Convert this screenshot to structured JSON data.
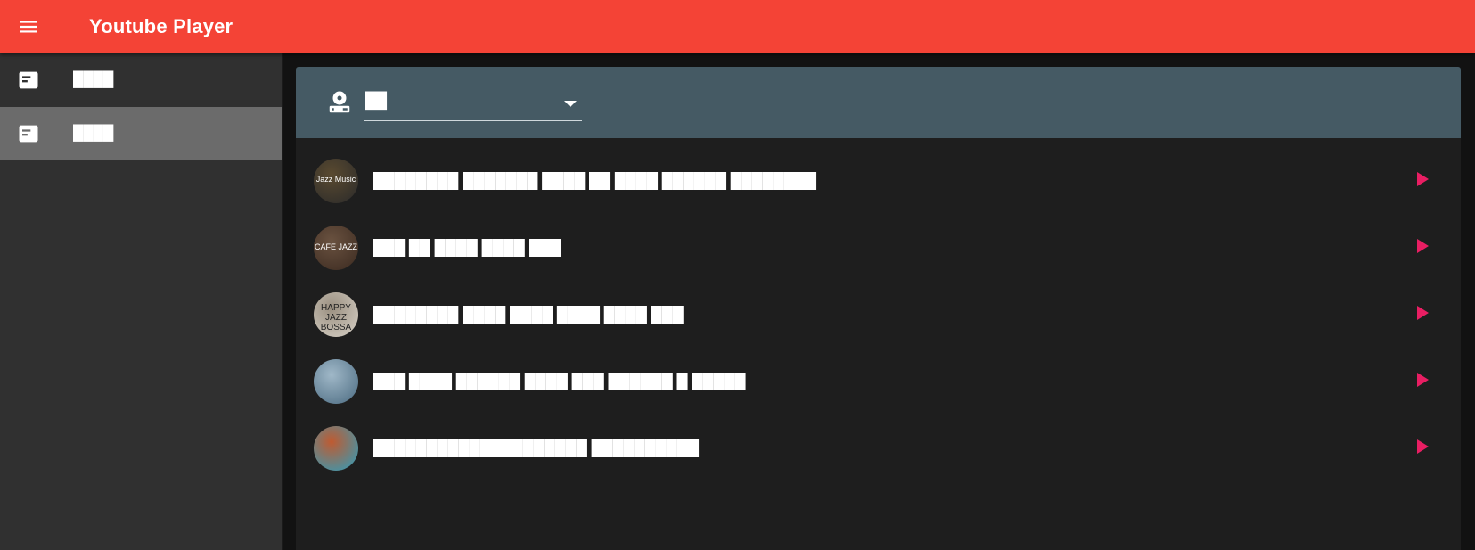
{
  "app": {
    "title": "Youtube Player"
  },
  "sidebar": {
    "items": [
      {
        "label": "████",
        "icon": "list-alt-icon",
        "active": false
      },
      {
        "label": "████",
        "icon": "list-alt-icon",
        "active": true
      }
    ]
  },
  "device_select": {
    "icon": "cast-device-icon",
    "value": "██"
  },
  "playlist": [
    {
      "title": "████████ ███████ ████ ██ ████ ██████ ████████",
      "thumb_text": "Jazz Music",
      "colors": [
        "#2a2a2a",
        "#5a4a30"
      ]
    },
    {
      "title": "███ ██ ████ ████ ███",
      "thumb_text": "CAFE JAZZ",
      "colors": [
        "#3b2a20",
        "#6a5240"
      ]
    },
    {
      "title": "████████ ████ ████ ████ ████ ███",
      "thumb_text": "HAPPY JAZZ BOSSA",
      "colors": [
        "#d8d2c8",
        "#9a8f80"
      ]
    },
    {
      "title": "███ ████ ██████ ████ ███ ██████ █ █████",
      "thumb_text": "",
      "colors": [
        "#4a6a80",
        "#a0b8c8"
      ]
    },
    {
      "title": "████████████████████ ██████████",
      "thumb_text": "",
      "colors": [
        "#2aa0c0",
        "#c05a30"
      ]
    }
  ],
  "colors": {
    "accent": "#f44336",
    "play": "#e91e63",
    "header": "#455a64"
  }
}
